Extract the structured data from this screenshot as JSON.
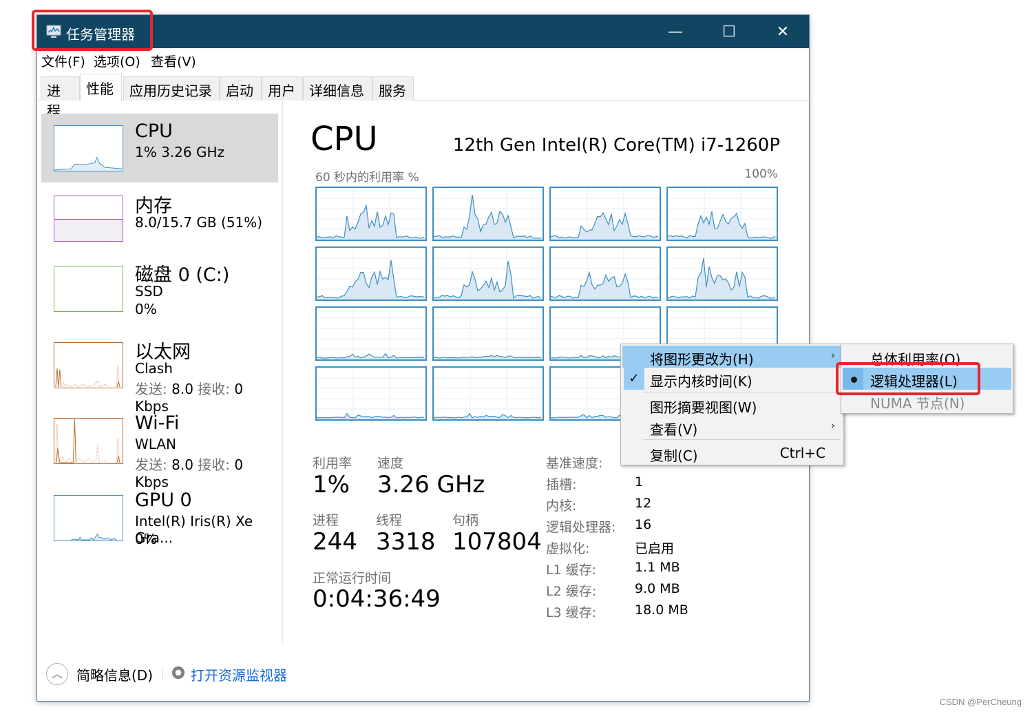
{
  "window": {
    "title": "任务管理器",
    "controls": {
      "minimize": "—",
      "maximize": "☐",
      "close": "✕"
    }
  },
  "menubar": [
    "文件(F)",
    "选项(O)",
    "查看(V)"
  ],
  "tabs": [
    {
      "label": "进程",
      "active": false
    },
    {
      "label": "性能",
      "active": true
    },
    {
      "label": "应用历史记录",
      "active": false
    },
    {
      "label": "启动",
      "active": false
    },
    {
      "label": "用户",
      "active": false
    },
    {
      "label": "详细信息",
      "active": false
    },
    {
      "label": "服务",
      "active": false
    }
  ],
  "sidebar": [
    {
      "title": "CPU",
      "line1": "1% 3.26 GHz",
      "line2": "",
      "color": "#3f8fc2",
      "selected": true
    },
    {
      "title": "内存",
      "line1": "8.0/15.7 GB (51%)",
      "line2": "",
      "color": "#a84ec4",
      "selected": false
    },
    {
      "title": "磁盘 0 (C:)",
      "line1": "SSD",
      "line2": "0%",
      "color": "#6bb84a",
      "selected": false
    },
    {
      "title": "以太网",
      "line1": "Clash",
      "line2_label_send": "发送:",
      "line2_send": "8.0",
      "line2_label_recv": "接收:",
      "line2_recv": "0 Kbps",
      "color": "#b8692d",
      "selected": false
    },
    {
      "title": "Wi-Fi",
      "line1": "WLAN",
      "line2_label_send": "发送:",
      "line2_send": "8.0",
      "line2_label_recv": "接收:",
      "line2_recv": "0 Kbps",
      "color": "#b8692d",
      "selected": false
    },
    {
      "title": "GPU 0",
      "line1": "Intel(R) Iris(R) Xe Gra...",
      "line2": "0%",
      "color": "#3f8fc2",
      "selected": false
    }
  ],
  "main": {
    "title": "CPU",
    "model": "12th Gen Intel(R) Core(TM) i7-1260P",
    "util_label": "60 秒内的利用率 %",
    "util_max": "100%",
    "stats": {
      "utilization_label": "利用率",
      "utilization": "1%",
      "speed_label": "速度",
      "speed": "3.26 GHz",
      "processes_label": "进程",
      "processes": "244",
      "threads_label": "线程",
      "threads": "3318",
      "handles_label": "句柄",
      "handles": "107804",
      "uptime_label": "正常运行时间",
      "uptime": "0:04:36:49"
    },
    "specs": [
      {
        "label": "基准速度:",
        "value": ""
      },
      {
        "label": "插槽:",
        "value": "1"
      },
      {
        "label": "内核:",
        "value": "12"
      },
      {
        "label": "逻辑处理器:",
        "value": "16"
      },
      {
        "label": "虚拟化:",
        "value": "已启用"
      },
      {
        "label": "L1 缓存:",
        "value": "1.1 MB"
      },
      {
        "label": "L2 缓存:",
        "value": "9.0 MB"
      },
      {
        "label": "L3 缓存:",
        "value": "18.0 MB"
      }
    ]
  },
  "context_menu": {
    "items": [
      {
        "label": "将图形更改为(H)",
        "submenu": true,
        "highlighted": true,
        "checked": false
      },
      {
        "label": "显示内核时间(K)",
        "submenu": false,
        "highlighted": false,
        "checked": true
      },
      {
        "label": "图形摘要视图(W)",
        "submenu": false,
        "highlighted": false,
        "checked": false
      },
      {
        "label": "查看(V)",
        "submenu": true,
        "highlighted": false,
        "checked": false
      },
      {
        "label": "复制(C)",
        "shortcut": "Ctrl+C",
        "submenu": false,
        "highlighted": false,
        "checked": false
      }
    ],
    "check_glyph": "✓",
    "arrow_glyph": "›"
  },
  "submenu": {
    "items": [
      {
        "label": "总体利用率(O)",
        "selected": false,
        "disabled": false
      },
      {
        "label": "逻辑处理器(L)",
        "selected": true,
        "disabled": false
      },
      {
        "label": "NUMA 节点(N)",
        "selected": false,
        "disabled": true
      }
    ]
  },
  "footer": {
    "collapse_glyph": "︿",
    "collapse_label": "简略信息(D)",
    "monitor_link": "打开资源监视器"
  },
  "watermark": "CSDN @PerCheung",
  "colors": {
    "titlebar": "#114663",
    "accent_cpu": "#3f8fc2",
    "menu_highlight": "#99ccf3",
    "annotation_red": "#e8252a",
    "link": "#1a6fd0"
  }
}
